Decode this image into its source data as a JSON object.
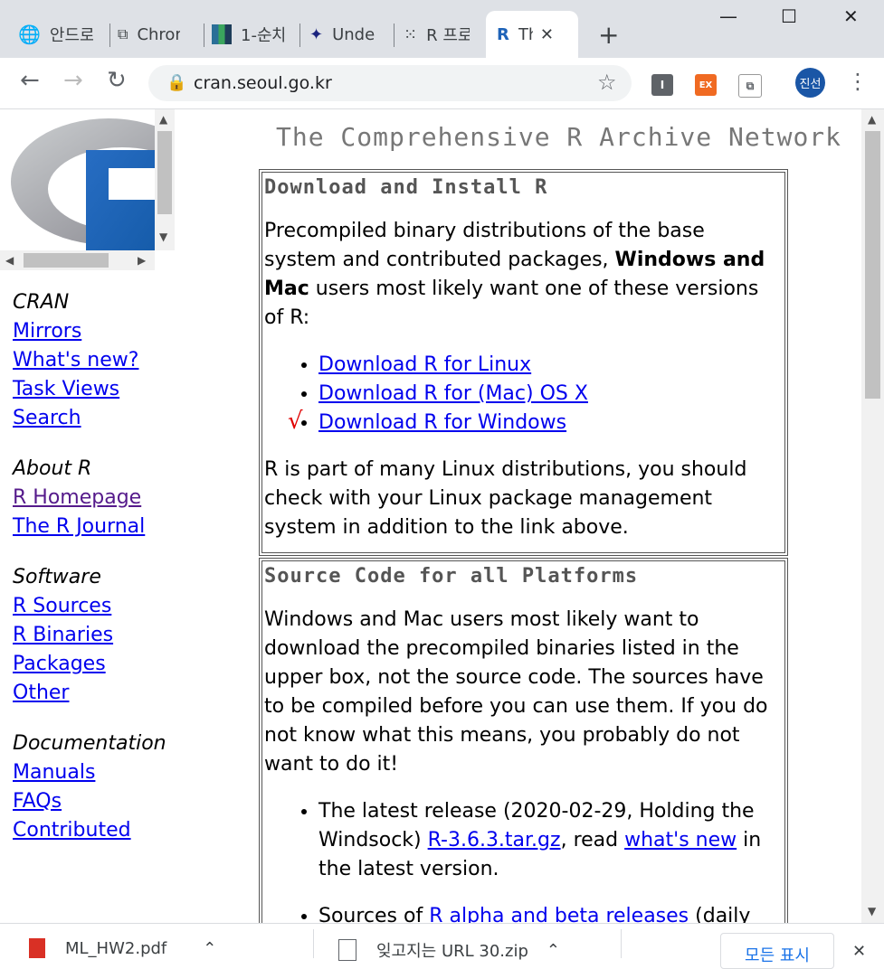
{
  "tabs": [
    {
      "label": "안드로",
      "icon": "globe-icon"
    },
    {
      "label": "Chrome",
      "icon": "chrome-cast-icon"
    },
    {
      "label": "1-순차",
      "icon": "bars-icon"
    },
    {
      "label": "Understand",
      "icon": "gallery-icon"
    },
    {
      "label": "R 프로",
      "icon": "dots-icon"
    },
    {
      "label": "The Comprehensive R Archive Network",
      "icon": "r-logo-icon",
      "active": true
    }
  ],
  "window": {
    "minimize": "—",
    "maximize": "☐",
    "close": "✕",
    "new_tab": "+"
  },
  "toolbar": {
    "url": "cran.seoul.go.kr",
    "ext1": "I",
    "ext2": "EX",
    "avatar": "진선"
  },
  "sidebar": {
    "sections": [
      {
        "heading": "CRAN",
        "links": [
          "Mirrors",
          "What's new?",
          "Task Views",
          "Search"
        ]
      },
      {
        "heading": "About R",
        "links": [
          "R Homepage",
          "The R Journal"
        ]
      },
      {
        "heading": "Software",
        "links": [
          "R Sources",
          "R Binaries",
          "Packages",
          "Other"
        ]
      },
      {
        "heading": "Documentation",
        "links": [
          "Manuals",
          "FAQs",
          "Contributed"
        ]
      }
    ]
  },
  "main": {
    "title": "The Comprehensive R Archive Network",
    "box1": {
      "heading": "Download and Install R",
      "intro_a": "Precompiled binary distributions of the base system and contributed packages, ",
      "intro_bold": "Windows and Mac",
      "intro_b": " users most likely want one of these versions of R:",
      "links": [
        "Download R for Linux",
        "Download R for (Mac) OS X",
        "Download R for Windows"
      ],
      "outro": "R is part of many Linux distributions, you should check with your Linux package management system in addition to the link above.",
      "check_mark": "√"
    },
    "box2": {
      "heading": "Source Code for all Platforms",
      "para": "Windows and Mac users most likely want to download the precompiled binaries listed in the upper box, not the source code. The sources have to be compiled before you can use them. If you do not know what this means, you probably do not want to do it!",
      "item_a": "The latest release (2020-02-29, Holding the Windsock) ",
      "item_link1": "R-3.6.3.tar.gz",
      "item_b": ", read ",
      "item_link2": "what's new",
      "item_c": " in the latest version.",
      "item2_a": "Sources of ",
      "item2_link": "R alpha and beta releases",
      "item2_b": " (daily"
    }
  },
  "downloads": {
    "items": [
      {
        "name": "ML_HW2.pdf"
      },
      {
        "name": "잊고지는 URL 30.zip"
      }
    ],
    "show_all": "모든 표시",
    "close": "✕"
  }
}
